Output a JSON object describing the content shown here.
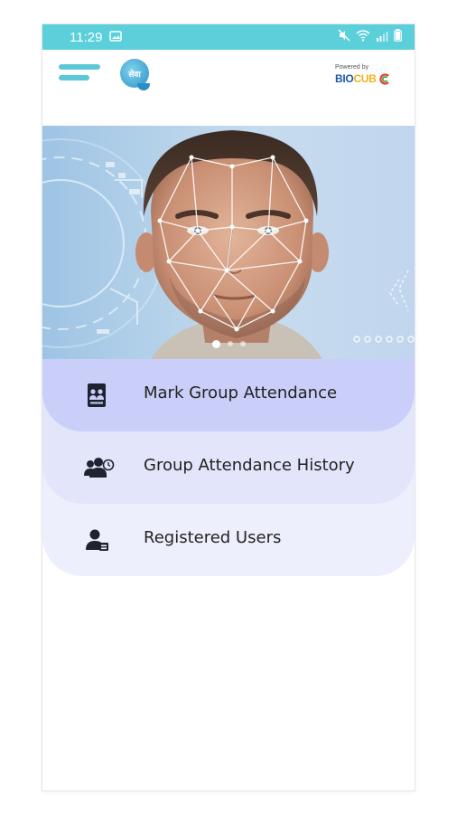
{
  "colors": {
    "status_bar": "#5bcfda",
    "menu_accent": "#5cc8d7",
    "card_active": "#c9cff8",
    "card_second": "#e3e5fb",
    "card_third": "#eeeffd"
  },
  "status_bar": {
    "time": "11:29"
  },
  "header": {
    "app_logo_text": "सेवा",
    "powered_by": "Powered by",
    "brand_bio": "BIO",
    "brand_cub": "CUB",
    "brand_c": "C"
  },
  "carousel": {
    "slides": 3,
    "active_slide": 1
  },
  "menu": [
    {
      "label": "Mark Group Attendance",
      "icon": "group-id-card-icon"
    },
    {
      "label": "Group Attendance History",
      "icon": "group-history-icon"
    },
    {
      "label": "Registered Users",
      "icon": "registered-user-icon"
    }
  ]
}
